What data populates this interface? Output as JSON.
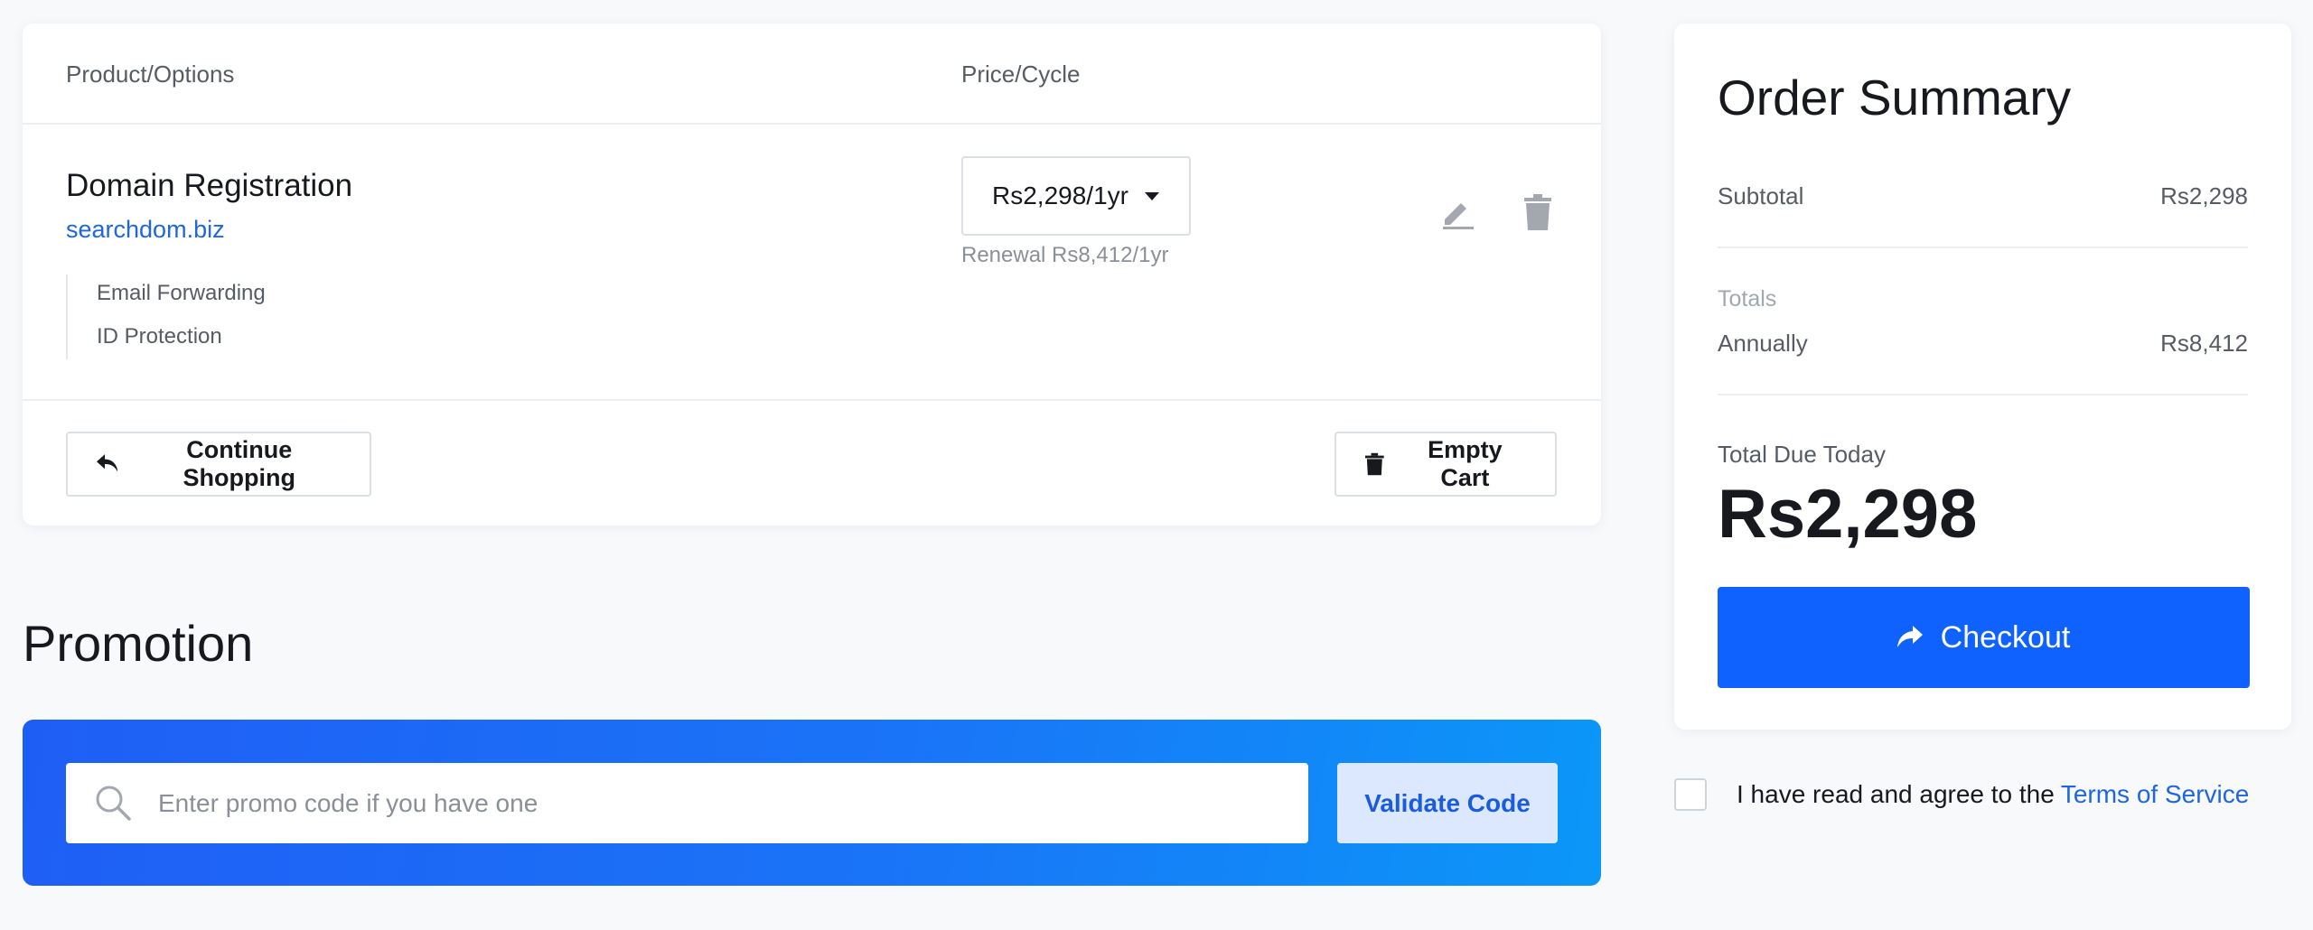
{
  "cart": {
    "headers": {
      "product": "Product/Options",
      "price": "Price/Cycle"
    },
    "item": {
      "name": "Domain Registration",
      "domain": "searchdom.biz",
      "addons": [
        "Email Forwarding",
        "ID Protection"
      ],
      "price_selected": "Rs2,298/1yr",
      "renewal": "Renewal Rs8,412/1yr"
    },
    "continue_label": "Continue Shopping",
    "empty_label": "Empty Cart"
  },
  "promotion": {
    "title": "Promotion",
    "placeholder": "Enter promo code if you have one",
    "validate_label": "Validate Code"
  },
  "summary": {
    "title": "Order Summary",
    "subtotal_label": "Subtotal",
    "subtotal_value": "Rs2,298",
    "totals_label": "Totals",
    "annually_label": "Annually",
    "annually_value": "Rs8,412",
    "due_label": "Total Due Today",
    "due_value": "Rs2,298",
    "checkout_label": "Checkout"
  },
  "tos": {
    "text": "I have read and agree to the",
    "link": "Terms of Service"
  },
  "icons": {
    "edit": "pencil-icon",
    "remove": "trash-icon",
    "continue": "reply-arrow-icon",
    "empty": "trash-icon",
    "search": "search-icon",
    "checkout": "share-arrow-icon"
  },
  "colors": {
    "accent": "#0f62fe",
    "link": "#1f66e0",
    "promo_gradient_start": "#1f5ef5",
    "promo_gradient_end": "#0b97f8"
  }
}
